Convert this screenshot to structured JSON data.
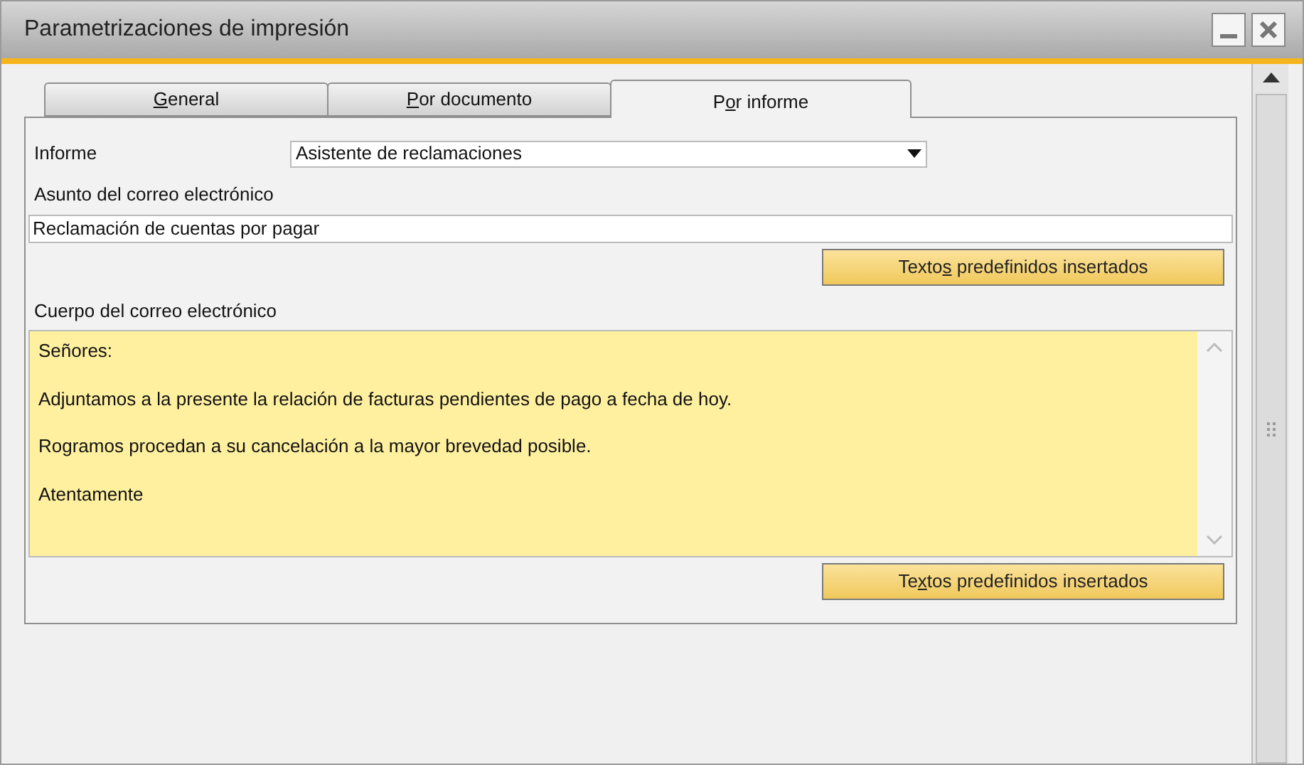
{
  "window": {
    "title": "Parametrizaciones de impresión"
  },
  "tabs": [
    {
      "label_key": "G",
      "label_after": "eneral",
      "selected": false
    },
    {
      "label_key": "P",
      "label_after": "or documento",
      "selected": false
    },
    {
      "label_before": "P",
      "label_key": "o",
      "label_after": "r informe",
      "selected": true
    }
  ],
  "report": {
    "label": "Informe",
    "value": "Asistente de reclamaciones"
  },
  "subject": {
    "label": "Asunto del correo electrónico",
    "value": "Reclamación de cuentas por pagar"
  },
  "subject_button": {
    "label_before": "Texto",
    "label_key": "s",
    "label_after": " predefinidos insertados"
  },
  "body": {
    "label": "Cuerpo del correo electrónico",
    "lines": [
      "Señores:",
      "Adjuntamos a la presente la relación de facturas pendientes de pago a fecha de hoy.",
      "Rogramos procedan a su cancelación a la mayor brevedad posible.",
      "Atentamente"
    ]
  },
  "body_button": {
    "label_before": "Te",
    "label_key": "x",
    "label_after": "tos predefinidos insertados"
  }
}
